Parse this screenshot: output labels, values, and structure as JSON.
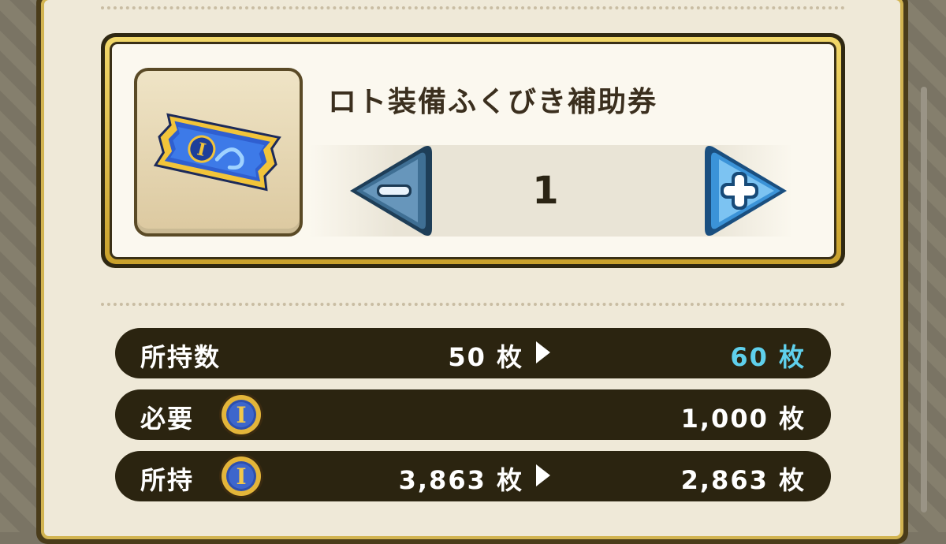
{
  "item": {
    "name": "ロト装備ふくびき補助券",
    "icon": "ticket-icon",
    "quantity": "1",
    "decrement_icon": "minus-icon",
    "increment_icon": "plus-icon"
  },
  "rows": {
    "owned_count": {
      "label": "所持数",
      "before": "50 枚",
      "after": "60 枚"
    },
    "required": {
      "label": "必要",
      "currency_icon": "coin-icon",
      "amount": "1,000 枚"
    },
    "holding": {
      "label": "所持",
      "currency_icon": "coin-icon",
      "before": "3,863 枚",
      "after": "2,863 枚"
    }
  },
  "colors": {
    "accent_cyan": "#5fd0ec",
    "gold_frame": "#d2b451",
    "row_bg": "#2b2410",
    "button_blue": "#4a9ad6"
  }
}
